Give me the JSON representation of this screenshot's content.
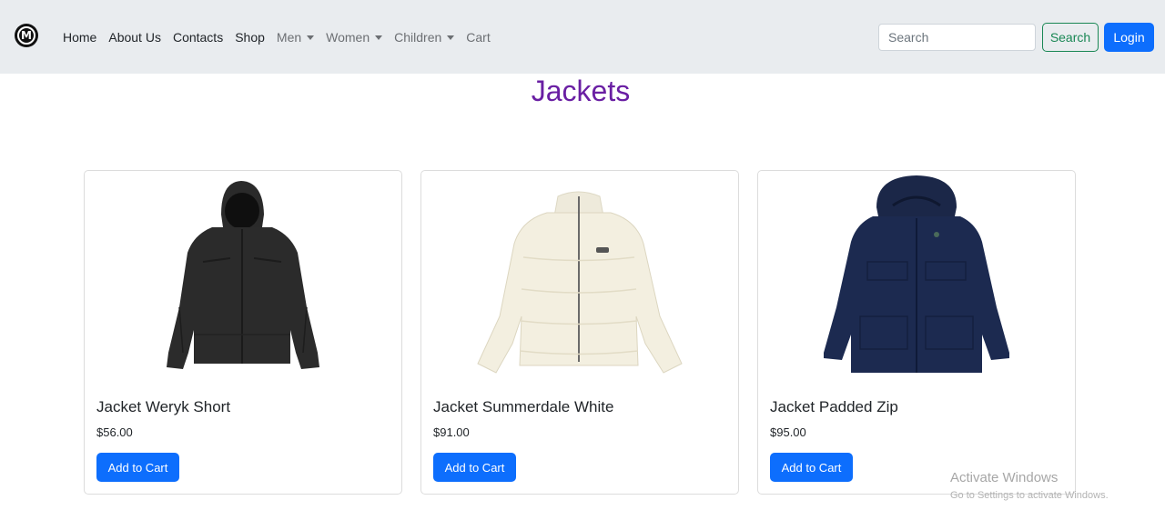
{
  "nav": {
    "logo_letter": "M",
    "links": [
      {
        "label": "Home"
      },
      {
        "label": "About Us"
      },
      {
        "label": "Contacts"
      },
      {
        "label": "Shop"
      },
      {
        "label": "Men"
      },
      {
        "label": "Women"
      },
      {
        "label": "Children"
      },
      {
        "label": "Cart"
      }
    ],
    "search_placeholder": "Search",
    "search_label": "Search",
    "login_label": "Login"
  },
  "page": {
    "title": "Jackets"
  },
  "products": [
    {
      "name": "Jacket Weryk Short",
      "price": "$56.00",
      "button": "Add to Cart",
      "image_icon": "black-hooded-jacket"
    },
    {
      "name": "Jacket Summerdale White",
      "price": "$91.00",
      "button": "Add to Cart",
      "image_icon": "cream-puffer-jacket"
    },
    {
      "name": "Jacket Padded Zip",
      "price": "$95.00",
      "button": "Add to Cart",
      "image_icon": "navy-parka-jacket"
    }
  ],
  "colors": {
    "title": "#6a1fa3",
    "primary": "#0d6efd",
    "success": "#198754",
    "navbar_bg": "#e9ecef"
  },
  "watermark": {
    "title": "Activate Windows",
    "subtitle": "Go to Settings to activate Windows."
  }
}
